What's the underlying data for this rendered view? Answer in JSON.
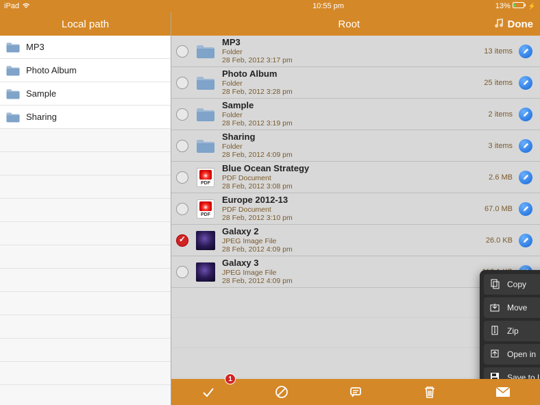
{
  "statusbar": {
    "device": "iPad",
    "time": "10:55 pm",
    "battery": "13%"
  },
  "sidebar": {
    "title": "Local path",
    "items": [
      {
        "label": "MP3"
      },
      {
        "label": "Photo Album"
      },
      {
        "label": "Sample"
      },
      {
        "label": "Sharing"
      }
    ]
  },
  "main": {
    "title": "Root",
    "done": "Done",
    "files": [
      {
        "name": "MP3",
        "kind": "Folder",
        "date": "28 Feb, 2012 3:17 pm",
        "meta": "13 items",
        "icon": "folder",
        "checked": false
      },
      {
        "name": "Photo Album",
        "kind": "Folder",
        "date": "28 Feb, 2012 3:28 pm",
        "meta": "25 items",
        "icon": "folder",
        "checked": false
      },
      {
        "name": "Sample",
        "kind": "Folder",
        "date": "28 Feb, 2012 3:19 pm",
        "meta": "2 items",
        "icon": "folder",
        "checked": false
      },
      {
        "name": "Sharing",
        "kind": "Folder",
        "date": "28 Feb, 2012 4:09 pm",
        "meta": "3 items",
        "icon": "folder",
        "checked": false
      },
      {
        "name": "Blue Ocean Strategy",
        "kind": "PDF Document",
        "date": "28 Feb, 2012 3:08 pm",
        "meta": "2.6 MB",
        "icon": "pdf",
        "checked": false
      },
      {
        "name": "Europe 2012-13",
        "kind": "PDF Document",
        "date": "28 Feb, 2012 3:10 pm",
        "meta": "67.0 MB",
        "icon": "pdf",
        "checked": false
      },
      {
        "name": "Galaxy 2",
        "kind": "JPEG Image File",
        "date": "28 Feb, 2012 4:09 pm",
        "meta": "26.0 KB",
        "icon": "image",
        "checked": true
      },
      {
        "name": "Galaxy 3",
        "kind": "JPEG Image File",
        "date": "28 Feb, 2012 4:09 pm",
        "meta": "113.1 KB",
        "icon": "image",
        "checked": false
      }
    ]
  },
  "toolbar": {
    "badge": "1"
  },
  "popover": {
    "items": [
      {
        "label": "Copy",
        "icon": "copy"
      },
      {
        "label": "Move",
        "icon": "move"
      },
      {
        "label": "Zip",
        "icon": "zip"
      },
      {
        "label": "Open in",
        "icon": "openin"
      },
      {
        "label": "Save to Library",
        "icon": "save"
      }
    ]
  }
}
